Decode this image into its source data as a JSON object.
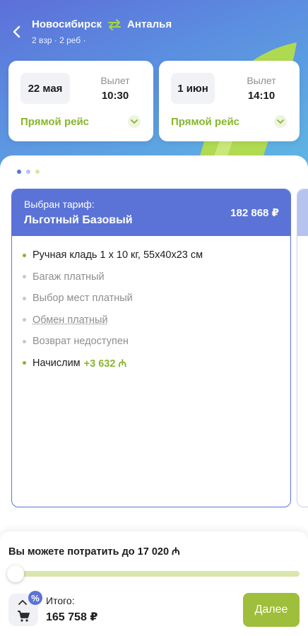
{
  "header": {
    "from_city": "Новосибирск",
    "to_city": "Анталья",
    "passengers": "2 взр · 2 реб ·"
  },
  "flights": [
    {
      "date": "22 мая",
      "dep_label": "Вылет",
      "dep_time": "10:30",
      "direct_label": "Прямой рейс"
    },
    {
      "date": "1 июн",
      "dep_label": "Вылет",
      "dep_time": "14:10",
      "direct_label": "Прямой рейс"
    }
  ],
  "tariff": {
    "chosen_label": "Выбран тариф:",
    "name": "Льготный Базовый",
    "price": "182 868 ₽",
    "features": [
      {
        "text": "Ручная кладь 1 х 10 кг, 55х40х23 см",
        "included": true
      },
      {
        "text": "Багаж платный",
        "included": false
      },
      {
        "text": "Выбор мест платный",
        "included": false
      },
      {
        "text": "Обмен платный",
        "included": false
      },
      {
        "text": "Возврат недоступен",
        "included": false
      },
      {
        "text": "Начислим",
        "bonus": "+3 632 ₼",
        "included": true
      }
    ]
  },
  "carousel": {
    "pages": 3,
    "active": 0
  },
  "footer": {
    "spend_text": "Вы можете потратить до 17 020 ₼",
    "total_label": "Итого:",
    "total_value": "165 758 ₽",
    "discount_badge": "%",
    "next_label": "Далее",
    "slider_value": 0
  },
  "colors": {
    "accent_blue": "#5b73d6",
    "accent_green": "#8ab52d",
    "button_green": "#9fbe3b",
    "slider_track": "#d9e6ac"
  },
  "icons": [
    "back-arrow-icon",
    "swap-arrows-icon",
    "chevron-down-icon",
    "chevron-up-icon",
    "cart-icon"
  ]
}
